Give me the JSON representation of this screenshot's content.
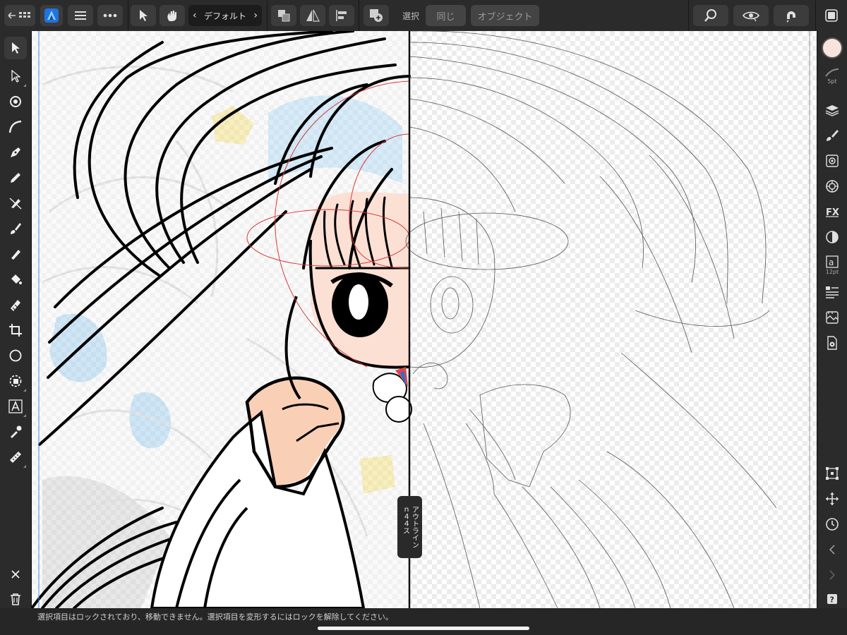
{
  "toolbar": {
    "back_icon": "back-grid-icon",
    "app_icon": "affinity-designer-icon",
    "menu_icon": "hamburger-icon",
    "more_icon": "ellipsis-icon",
    "move_tool_icon": "pointer-icon",
    "gesture_icon": "hand-gesture-icon",
    "preset_label": "デフォルト",
    "arrange_icon": "arrange-icon",
    "flip_icon": "flip-icon",
    "align_icon": "align-icon",
    "boolean_icon": "boolean-add-icon",
    "select_label": "選択",
    "same_label": "同じ",
    "object_label": "オブジェクト",
    "zoom_icon": "zoom-icon",
    "view_mode_icon": "view-mode-icon",
    "snapping_icon": "snapping-magnet-icon",
    "studio_icon": "studio-toggle-icon"
  },
  "left_tools": [
    "move-tool",
    "node-tool",
    "corner-tool",
    "pencil-tool",
    "pen-tool",
    "vector-brush-tool",
    "pixel-erase-tool",
    "paint-brush-tool",
    "color-picker-tool",
    "fill-tool",
    "transparency-tool",
    "crop-tool",
    "ellipse-tool",
    "shape-tool",
    "artistic-text-tool",
    "eyedropper-tool",
    "measure-tool"
  ],
  "left_bottom": [
    "delete-x-icon",
    "trash-icon"
  ],
  "right_panel": {
    "color_swatch": "#f8e4dc",
    "stroke_width_label": "5pt",
    "text_size_label": "12pt"
  },
  "split_view": {
    "label_line1": "アウトライン",
    "label_line2": "ｎ４４ス"
  },
  "status": {
    "message": "選択項目はロックされており、移動できません。選択項目を変形するにはロックを解除してください。"
  },
  "colors": {
    "accent": "#1f74e0",
    "ui_bg": "#2b2b2b",
    "skin": "#fde0d4",
    "guide_red": "#d83a3a"
  }
}
